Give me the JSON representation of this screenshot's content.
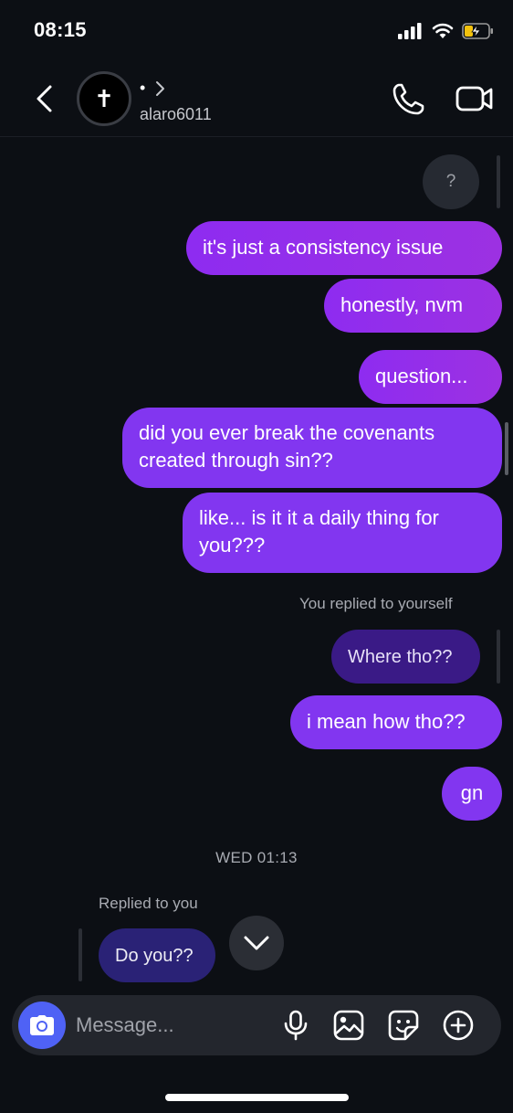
{
  "status_bar": {
    "time": "08:15"
  },
  "header": {
    "avatar_glyph": "✝",
    "display_name": "•",
    "username": "alaro6011",
    "icons": [
      "back-chevron-icon",
      "chevron-right-icon",
      "phone-icon",
      "video-camera-icon"
    ]
  },
  "thread": {
    "question_bubble": "?",
    "messages": [
      {
        "text": "it's just a consistency issue",
        "direction": "outgoing"
      },
      {
        "text": "honestly, nvm",
        "direction": "outgoing"
      },
      {
        "text": "question...",
        "direction": "outgoing"
      },
      {
        "text": "did you ever break the covenants created through sin??",
        "line1": "did you ever break the covenants",
        "line2": "created through sin??",
        "direction": "outgoing"
      },
      {
        "text": "like... is it it a daily thing for you???",
        "line1": "like... is it it a daily thing for",
        "line2": "you???",
        "direction": "outgoing"
      }
    ],
    "reply_label_self": "You replied to yourself",
    "replied_message": "Where tho??",
    "after_reply": [
      {
        "text": "i mean how tho??",
        "direction": "outgoing"
      },
      {
        "text": "gn",
        "direction": "outgoing"
      }
    ],
    "date_divider": "WED 01:13",
    "reply_label_in": "Replied to you",
    "incoming": {
      "text": "Do you??",
      "direction": "incoming"
    }
  },
  "composer": {
    "placeholder": "Message...",
    "icons": [
      "camera-icon",
      "microphone-icon",
      "gallery-icon",
      "sticker-icon",
      "plus-icon"
    ]
  },
  "colors": {
    "background": "#0c0f14",
    "outgoing_bubble": "#8e2cf0",
    "reply_bubble": "#3a1a86",
    "incoming_bubble": "#2a2276",
    "camera_button": "#4f62f5"
  }
}
